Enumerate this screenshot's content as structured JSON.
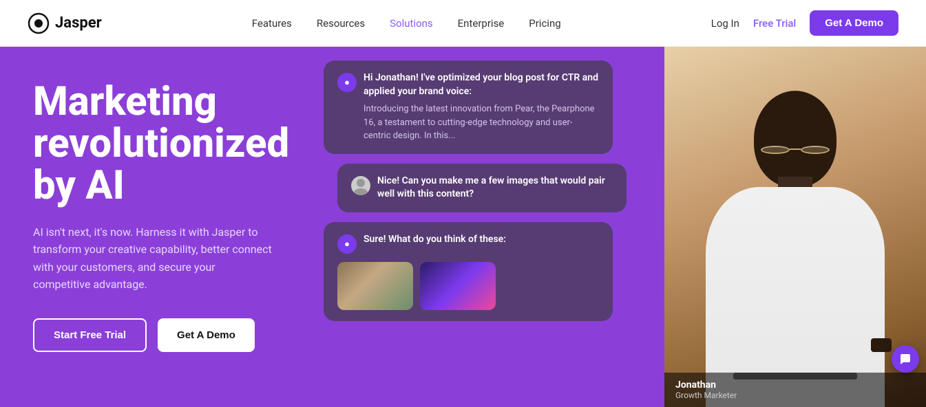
{
  "nav": {
    "logo_text": "Jasper",
    "links": [
      {
        "label": "Features",
        "id": "features"
      },
      {
        "label": "Resources",
        "id": "resources"
      },
      {
        "label": "Solutions",
        "id": "solutions",
        "highlight": true
      },
      {
        "label": "Enterprise",
        "id": "enterprise"
      },
      {
        "label": "Pricing",
        "id": "pricing"
      }
    ],
    "login_label": "Log In",
    "free_trial_label": "Free Trial",
    "get_demo_label": "Get A Demo"
  },
  "hero": {
    "title": "Marketing revolutionized by AI",
    "subtitle": "AI isn't next, it's now. Harness it with Jasper to transform your creative capability, better connect with your customers, and secure your competitive advantage.",
    "btn_trial": "Start Free Trial",
    "btn_demo": "Get A Demo"
  },
  "chat": {
    "bubble1": {
      "bold": "Hi Jonathan! I've optimized your blog post for CTR and applied your brand voice:",
      "body": "Introducing the latest innovation from Pear, the Pearphone 16, a testament to cutting-edge technology and user-centric design. In this..."
    },
    "bubble2": {
      "text": "Nice! Can you make me a few images that would pair well with this content?"
    },
    "bubble3": {
      "text": "Sure! What do you think of these:"
    }
  },
  "person": {
    "name": "Jonathan",
    "role": "Growth Marketer"
  },
  "colors": {
    "purple": "#8B3FD8",
    "purple_dark": "#7C3AED",
    "solutions_color": "#8B5CF6"
  }
}
